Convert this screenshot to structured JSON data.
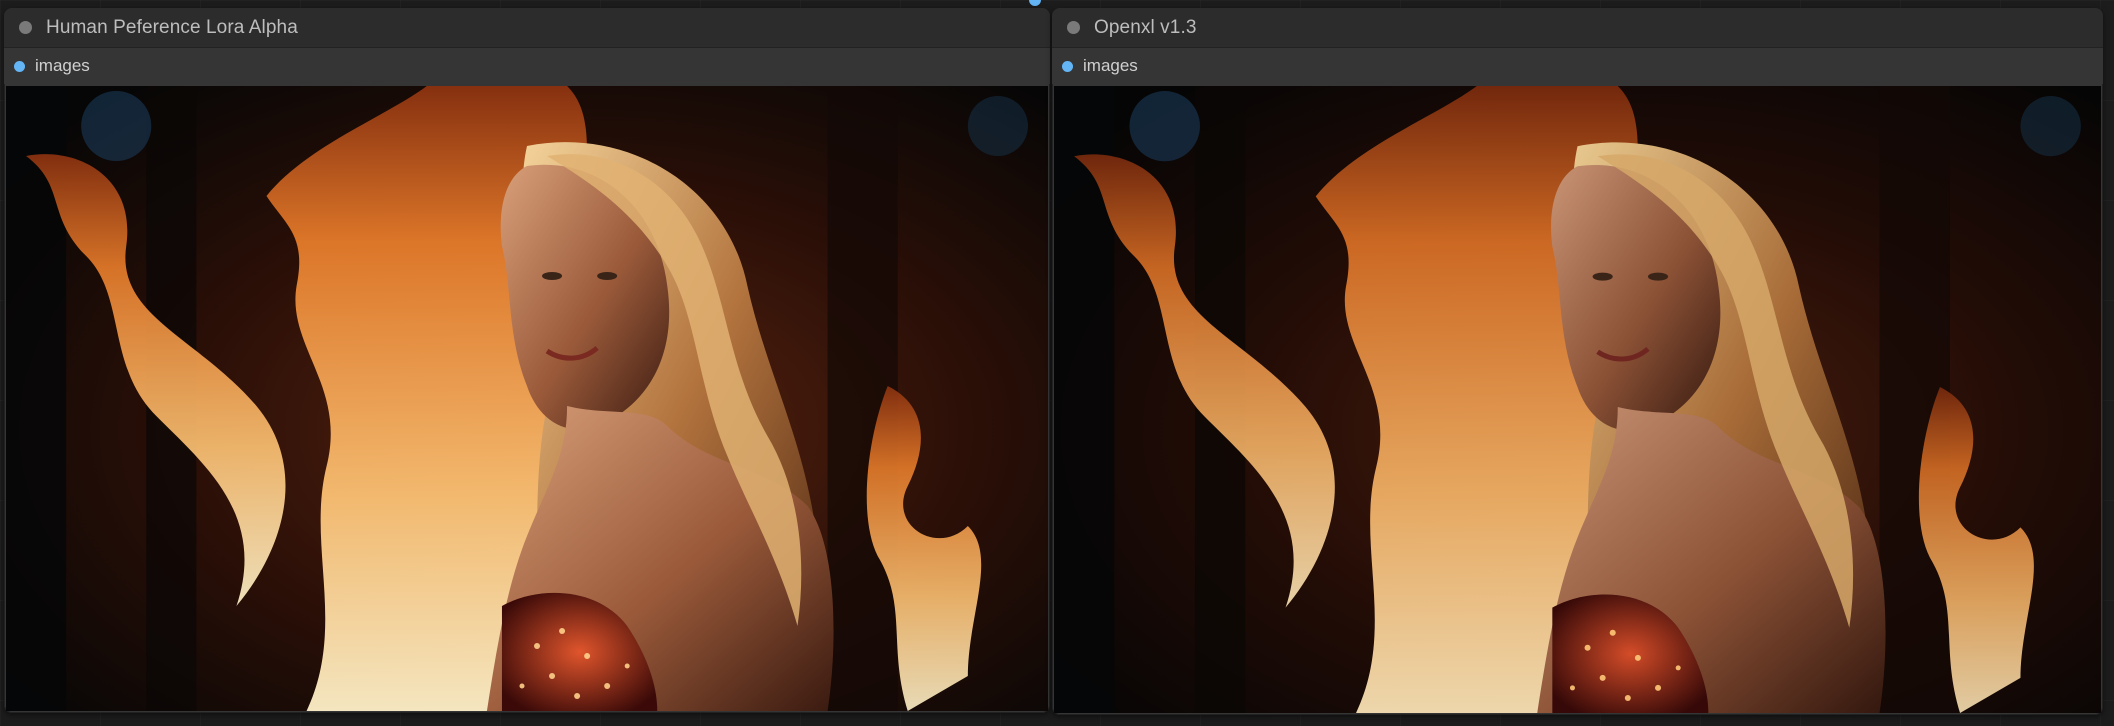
{
  "nodes": [
    {
      "title": "Human Peference Lora Alpha",
      "output_slot": "images",
      "slot_color": "#64b5f6"
    },
    {
      "title": "Openxl v1.3",
      "output_slot": "images",
      "slot_color": "#64b5f6"
    }
  ],
  "icons": {
    "collapse": "collapse-dot-icon",
    "slot": "slot-dot-icon"
  },
  "colors": {
    "node_bg": "#353535",
    "header_bg": "#2c2c2c",
    "canvas_bg": "#1c1c1c",
    "fire_orange": "#f7a24a"
  }
}
